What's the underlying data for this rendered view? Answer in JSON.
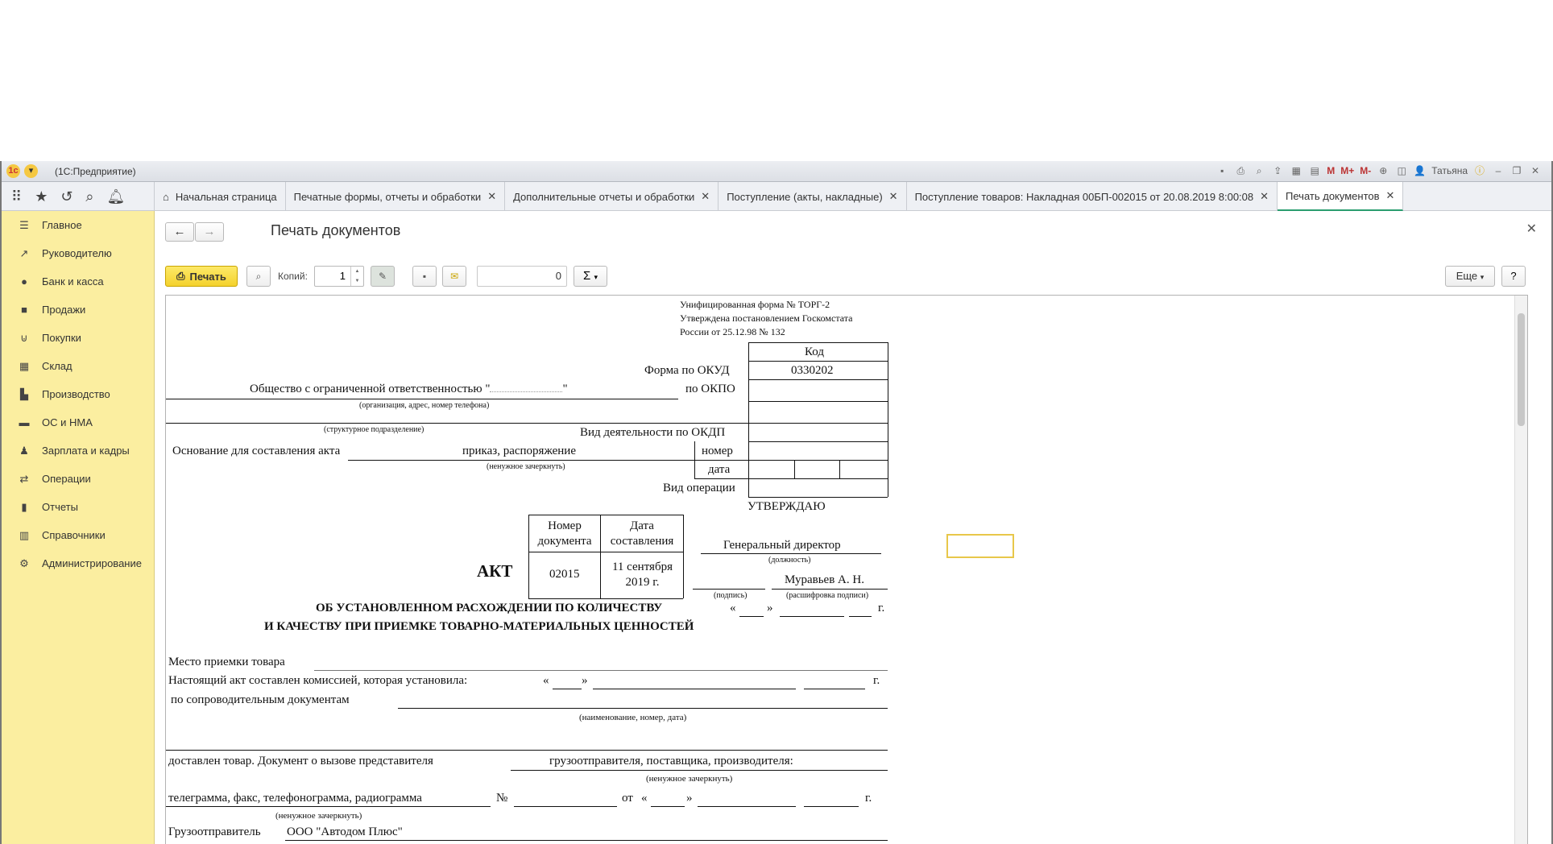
{
  "titlebar": {
    "title": "(1С:Предприятие)",
    "user": "Татьяна",
    "m1": "M",
    "m2": "M+",
    "m3": "M-"
  },
  "tabs": [
    {
      "label": "Начальная страница"
    },
    {
      "label": "Печатные формы, отчеты и обработки"
    },
    {
      "label": "Дополнительные отчеты и обработки"
    },
    {
      "label": "Поступление (акты, накладные)"
    },
    {
      "label": "Поступление товаров: Накладная 00БП-002015 от 20.08.2019 8:00:08"
    },
    {
      "label": "Печать документов"
    }
  ],
  "sidebar": [
    {
      "label": "Главное"
    },
    {
      "label": "Руководителю"
    },
    {
      "label": "Банк и касса"
    },
    {
      "label": "Продажи"
    },
    {
      "label": "Покупки"
    },
    {
      "label": "Склад"
    },
    {
      "label": "Производство"
    },
    {
      "label": "ОС и НМА"
    },
    {
      "label": "Зарплата и кадры"
    },
    {
      "label": "Операции"
    },
    {
      "label": "Отчеты"
    },
    {
      "label": "Справочники"
    },
    {
      "label": "Администрирование"
    }
  ],
  "content": {
    "title": "Печать документов",
    "toolbar": {
      "print": "Печать",
      "copies_label": "Копий:",
      "copies": "1",
      "counter": "0",
      "sum": "Σ",
      "more": "Еще",
      "help": "?"
    }
  },
  "doc": {
    "h1": "Унифицированная форма № ТОРГ-2",
    "h2": "Утверждена постановлением Госкомстата",
    "h3": "России от 25.12.98 № 132",
    "code": "Код",
    "okud_label": "Форма по ОКУД",
    "okud": "0330202",
    "okpo_label": "по ОКПО",
    "org": "Общество с ограниченной ответственностью \"",
    "org_end": "\"",
    "org_note": "(организация, адрес, номер телефона)",
    "div_note": "(структурное подразделение)",
    "okdp": "Вид деятельности по ОКДП",
    "basis": "Основание для составления акта",
    "basis_val": "приказ, распоряжение",
    "nomer": "номер",
    "data": "дата",
    "crossout": "(ненужное зачеркнуть)",
    "vid_op": "Вид операции",
    "approve": "УТВЕРЖДАЮ",
    "doc_num_h": "Номер документа",
    "doc_date_h": "Дата составления",
    "akt": "АКТ",
    "doc_num": "02015",
    "doc_date": "11 сентября 2019 г.",
    "position": "Генеральный директор",
    "position_note": "(должность)",
    "sign_note": "(подпись)",
    "signer": "Муравьев А. Н.",
    "signer_note": "(расшифровка подписи)",
    "t1": "ОБ УСТАНОВЛЕННОМ РАСХОЖДЕНИИ ПО КОЛИЧЕСТВУ",
    "t2": "И КАЧЕСТВУ ПРИ ПРИЕМКЕ ТОВАРНО-МАТЕРИАЛЬНЫХ ЦЕННОСТЕЙ",
    "q_open": "«",
    "q_close": "»",
    "year": "г.",
    "place": "Место приемки товара",
    "commission": "Настоящий акт составлен комиссией, которая установила:",
    "accomp": "по сопроводительным документам",
    "accomp_note": "(наименование, номер, дата)",
    "delivered": "доставлен товар.  Документ о вызове представителя",
    "shipper_line": "грузоотправителя, поставщика, производителя:",
    "crossout2": "(ненужное зачеркнуть)",
    "telegram": "телеграмма, факс, телефонограмма, радиограмма",
    "num_sign": "№",
    "from": "от",
    "crossout3": "(ненужное зачеркнуть)",
    "shipper": "Грузоотправитель",
    "shipper_val": "ООО \"Автодом Плюс\""
  }
}
